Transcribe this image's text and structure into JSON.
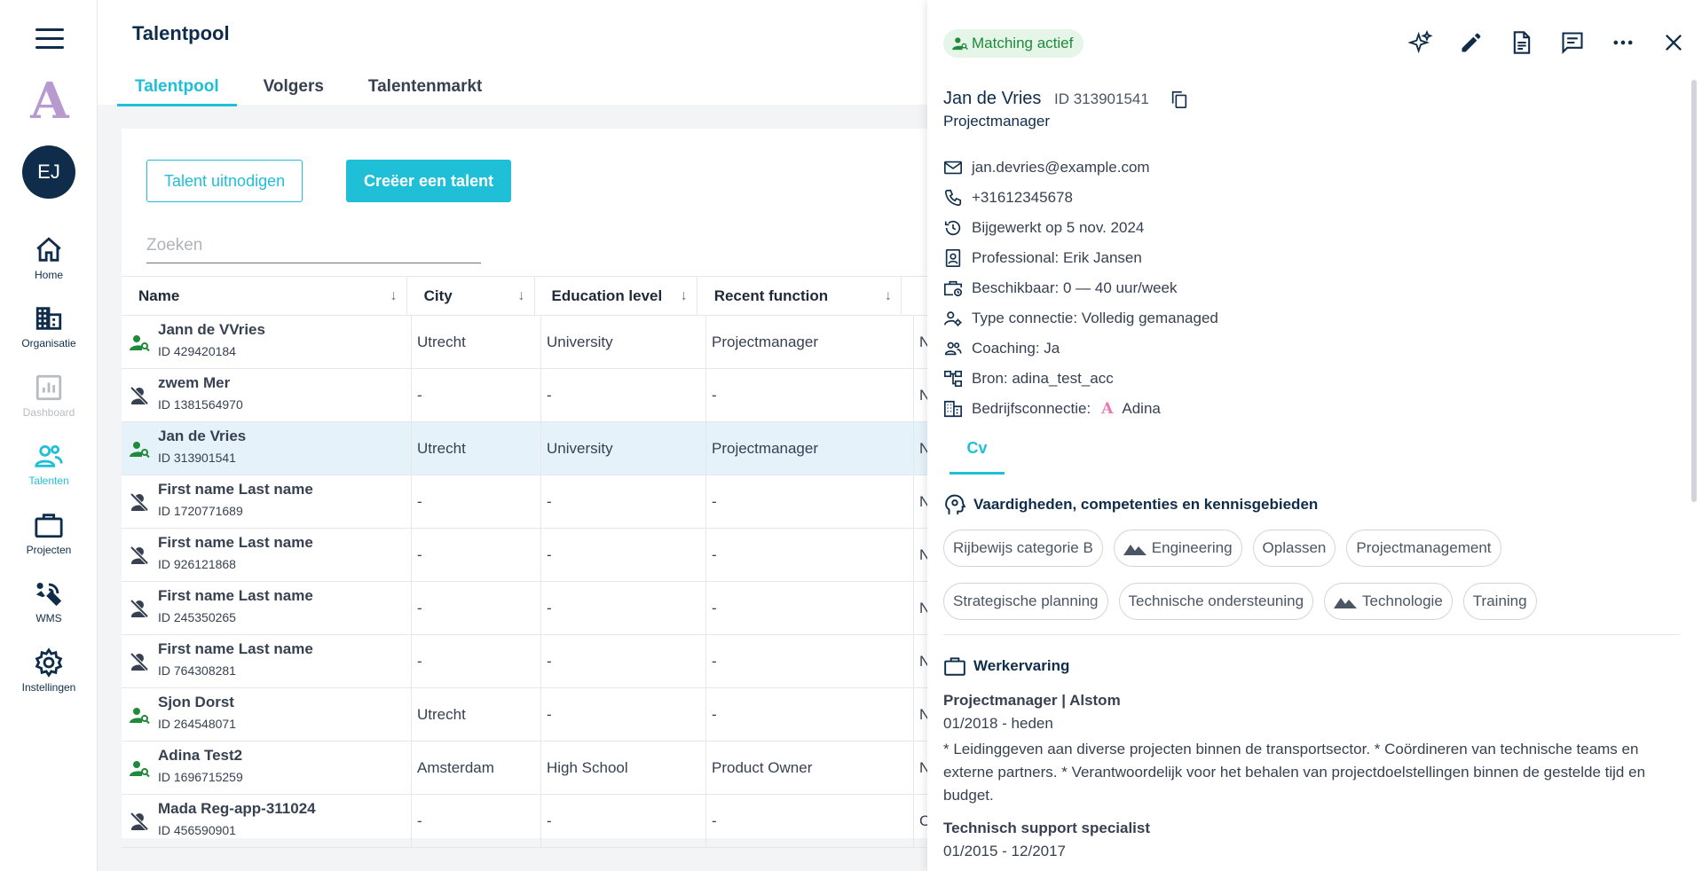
{
  "nav": {
    "avatar_initials": "EJ",
    "logo_letter": "A",
    "items": [
      {
        "label": "Home",
        "icon": "home-icon",
        "state": "normal"
      },
      {
        "label": "Organisatie",
        "icon": "building-icon",
        "state": "normal"
      },
      {
        "label": "Dashboard",
        "icon": "chart-icon",
        "state": "disabled"
      },
      {
        "label": "Talenten",
        "icon": "people-icon",
        "state": "active"
      },
      {
        "label": "Projecten",
        "icon": "briefcase-icon",
        "state": "normal"
      },
      {
        "label": "WMS",
        "icon": "wms-icon",
        "state": "normal"
      },
      {
        "label": "Instellingen",
        "icon": "gear-icon",
        "state": "normal"
      }
    ]
  },
  "main": {
    "title": "Talentpool",
    "tabs": [
      "Talentpool",
      "Volgers",
      "Talentenmarkt"
    ],
    "active_tab": "Talentpool",
    "invite_button": "Talent uitnodigen",
    "create_button": "Creëer een talent",
    "search_placeholder": "Zoeken",
    "columns": [
      "Name",
      "City",
      "Education level",
      "Recent function"
    ],
    "rows": [
      {
        "name": "Jann de VVries",
        "id": "ID 429420184",
        "city": "Utrecht",
        "education": "University",
        "function": "Projectmanager",
        "extra": "N",
        "status": "active"
      },
      {
        "name": "zwem Mer",
        "id": "ID 1381564970",
        "city": "-",
        "education": "-",
        "function": "-",
        "extra": "N",
        "status": "inactive"
      },
      {
        "name": "Jan de Vries",
        "id": "ID 313901541",
        "city": "Utrecht",
        "education": "University",
        "function": "Projectmanager",
        "extra": "N",
        "status": "active"
      },
      {
        "name": "First name Last name",
        "id": "ID 1720771689",
        "city": "-",
        "education": "-",
        "function": "-",
        "extra": "N",
        "status": "inactive"
      },
      {
        "name": "First name Last name",
        "id": "ID 926121868",
        "city": "-",
        "education": "-",
        "function": "-",
        "extra": "N",
        "status": "inactive"
      },
      {
        "name": "First name Last name",
        "id": "ID 245350265",
        "city": "-",
        "education": "-",
        "function": "-",
        "extra": "N",
        "status": "inactive"
      },
      {
        "name": "First name Last name",
        "id": "ID 764308281",
        "city": "-",
        "education": "-",
        "function": "-",
        "extra": "N",
        "status": "inactive"
      },
      {
        "name": "Sjon Dorst",
        "id": "ID 264548071",
        "city": "Utrecht",
        "education": "-",
        "function": "-",
        "extra": "N",
        "status": "active"
      },
      {
        "name": "Adina Test2",
        "id": "ID 1696715259",
        "city": "Amsterdam",
        "education": "High School",
        "function": "Product Owner",
        "extra": "N",
        "status": "active"
      },
      {
        "name": "Mada Reg-app-311024",
        "id": "ID 456590901",
        "city": "-",
        "education": "-",
        "function": "-",
        "extra": "C",
        "status": "inactive"
      }
    ],
    "selected_row": 2
  },
  "panel": {
    "badge": "Matching actief",
    "toolbar_icons": [
      "sparkle-icon",
      "pencil-icon",
      "document-icon",
      "comment-icon",
      "more-icon",
      "close-icon"
    ],
    "name": "Jan de Vries",
    "id": "ID 313901541",
    "role": "Projectmanager",
    "info": {
      "email": "jan.devries@example.com",
      "phone": "+31612345678",
      "updated": "Bijgewerkt op 5 nov. 2024",
      "professional": "Professional: Erik Jansen",
      "availability": "Beschikbaar: 0 — 40 uur/week",
      "connection": "Type connectie: Volledig gemanaged",
      "coaching": "Coaching: Ja",
      "source": "Bron: adina_test_acc",
      "company_label": "Bedrijfsconnectie:",
      "company_name": "Adina"
    },
    "cv_tab": "Cv",
    "skills_title": "Vaardigheden, competenties en kennisgebieden",
    "skills": [
      {
        "label": "Rijbewijs categorie B",
        "icon": false
      },
      {
        "label": "Engineering",
        "icon": true
      },
      {
        "label": "Oplassen",
        "icon": false
      },
      {
        "label": "Projectmanagement",
        "icon": false
      },
      {
        "label": "Strategische planning",
        "icon": false
      },
      {
        "label": "Technische ondersteuning",
        "icon": false
      },
      {
        "label": "Technologie",
        "icon": true
      },
      {
        "label": "Training",
        "icon": false
      }
    ],
    "experience_title": "Werkervaring",
    "experience": [
      {
        "title": "Projectmanager | Alstom",
        "dates": "01/2018 - heden",
        "description": "* Leidinggeven aan diverse projecten binnen de transportsector. * Coördineren van technische teams en externe partners. * Verantwoordelijk voor het behalen van projectdoelstellingen binnen de gestelde tijd en budget."
      },
      {
        "title": "Technisch support specialist",
        "dates": "01/2015 - 12/2017",
        "description": ""
      }
    ]
  }
}
